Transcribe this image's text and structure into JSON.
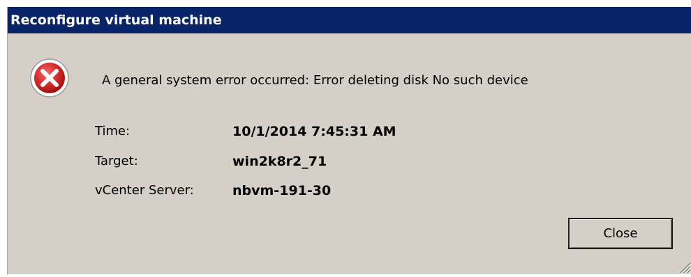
{
  "dialog": {
    "title": "Reconfigure virtual machine",
    "message": "A general system error occurred: Error deleting disk No such device",
    "icon": "error-icon",
    "details": {
      "time_label": "Time:",
      "time_value": "10/1/2014 7:45:31 AM",
      "target_label": "Target:",
      "target_value": "win2k8r2_71",
      "vcenter_label": "vCenter Server:",
      "vcenter_value": "nbvm-191-30"
    },
    "close_label": "Close"
  },
  "colors": {
    "titlebar": "#0a246a",
    "dialog_background": "#d4d0c8",
    "error_red": "#d32f2f"
  }
}
